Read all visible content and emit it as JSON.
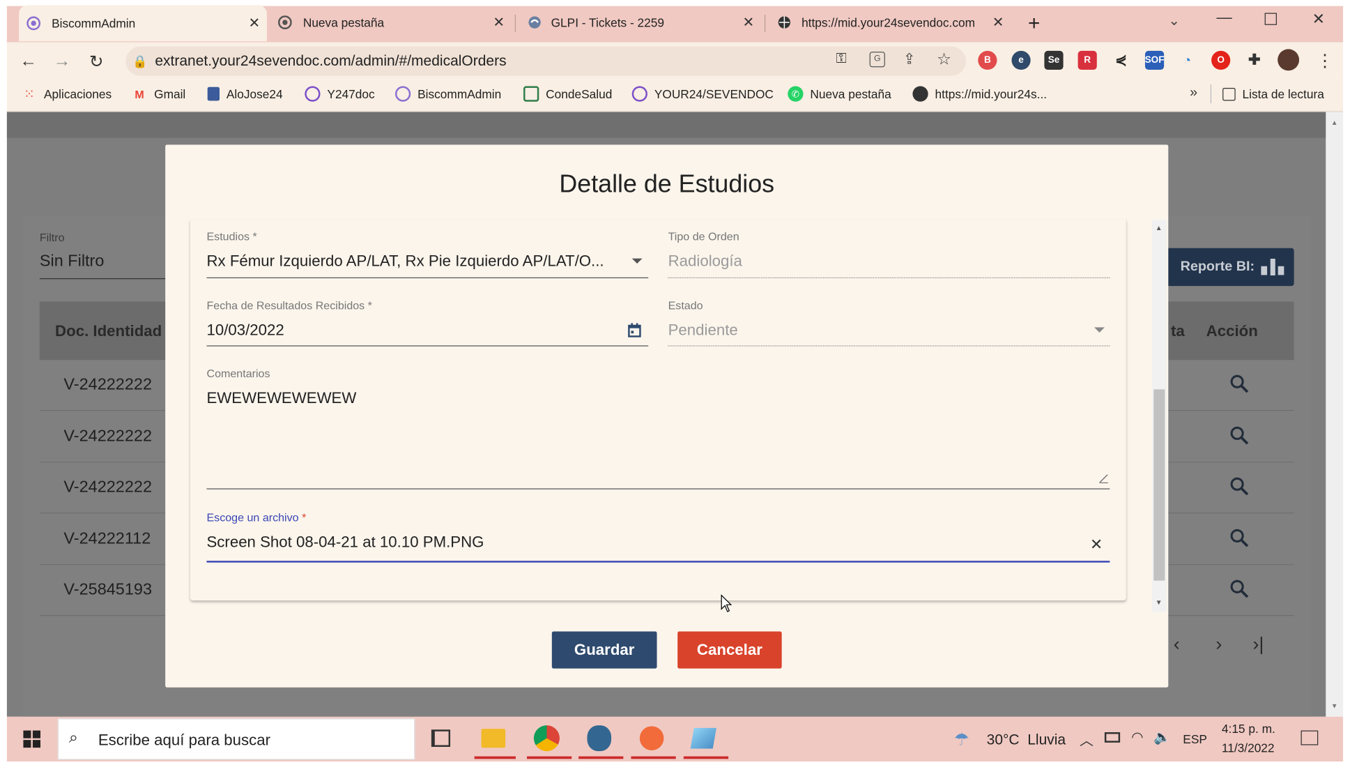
{
  "browser": {
    "tabs": [
      {
        "title": "BiscommAdmin"
      },
      {
        "title": "Nueva pestaña"
      },
      {
        "title": "GLPI - Tickets - 2259"
      },
      {
        "title": "https://mid.your24sevendoc.com"
      }
    ],
    "url": "extranet.your24sevendoc.com/admin/#/medicalOrders",
    "bookmarks": [
      {
        "label": "Aplicaciones"
      },
      {
        "label": "Gmail"
      },
      {
        "label": "AloJose24"
      },
      {
        "label": "Y247doc"
      },
      {
        "label": "BiscommAdmin"
      },
      {
        "label": "CondeSalud"
      },
      {
        "label": "YOUR24/SEVENDOC"
      },
      {
        "label": "Nueva pestaña"
      },
      {
        "label": "https://mid.your24s..."
      }
    ],
    "reading_list": "Lista de lectura",
    "more": "»"
  },
  "background": {
    "filter_label": "Filtro",
    "filter_value": "Sin Filtro",
    "report_button": "Reporte BI:",
    "col_doc": "Doc. Identidad",
    "col_partial": "ta",
    "col_action": "Acción",
    "rows": [
      "V-24222222",
      "V-24222222",
      "V-24222222",
      "V-24222112",
      "V-25845193"
    ]
  },
  "modal": {
    "title": "Detalle de Estudios",
    "estudios_label": "Estudios *",
    "estudios_value": "Rx Fémur Izquierdo AP/LAT, Rx Pie Izquierdo AP/LAT/O...",
    "tipo_label": "Tipo de Orden",
    "tipo_value": "Radiología",
    "fecha_label": "Fecha de Resultados Recibidos *",
    "fecha_value": "10/03/2022",
    "estado_label": "Estado",
    "estado_value": "Pendiente",
    "comentarios_label": "Comentarios",
    "comentarios_value": "EWEWEWEWEWEW",
    "archivo_label": "Escoge un archivo",
    "archivo_req": "*",
    "archivo_value": "Screen Shot 08-04-21 at 10.10 PM.PNG",
    "save": "Guardar",
    "cancel": "Cancelar"
  },
  "taskbar": {
    "search_placeholder": "Escribe aquí para buscar",
    "weather": "30°C  Lluvia",
    "lang": "ESP",
    "time": "4:15 p. m.",
    "date": "11/3/2022"
  },
  "colors": {
    "primary": "#2e4a6e",
    "danger": "#d9432b",
    "accent": "#3b46b5"
  }
}
